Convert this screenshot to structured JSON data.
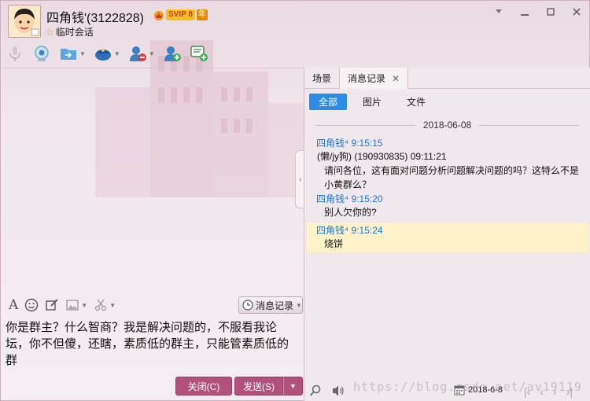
{
  "header": {
    "contact_name": "四角钱'(3122828)",
    "vip_label": "SVIP 8",
    "year_label": "年",
    "session_type": "临时会话"
  },
  "toolbar": {
    "icons": [
      "microphone-icon",
      "video-call-icon",
      "file-transfer-icon",
      "remote-assist-icon",
      "remove-user-icon",
      "add-user-icon",
      "message-icon"
    ]
  },
  "input_toolbar": {
    "history_label": "消息记录"
  },
  "input": {
    "text": "你是群主？什么智商？我是解决问题的，不服看我论坛，你不但傻，还瞎，素质低的群主，只能管素质低的群"
  },
  "actions": {
    "close_label": "关闭(C)",
    "send_label": "发送(S)"
  },
  "right_tabs": [
    {
      "label": "场景"
    },
    {
      "label": "消息记录"
    }
  ],
  "filters": [
    {
      "label": "全部"
    },
    {
      "label": "图片"
    },
    {
      "label": "文件"
    }
  ],
  "history": {
    "date": "2018-06-08",
    "messages": [
      {
        "sender": "四角钱⁴",
        "time": "9:15:15",
        "quote": "(懒/jy狗) (190930835)  09:11:21",
        "body": "请问各位，这有面对问题分析问题解决问题的吗？这特么不是小黄群么？"
      },
      {
        "sender": "四角钱⁴",
        "time": "9:15:20",
        "body": "别人欠你的?"
      },
      {
        "sender": "四角钱⁴",
        "time": "9:15:24",
        "body": "烧饼"
      }
    ]
  },
  "bottom": {
    "calendar_date": "2018-6-8",
    "watermark": "https://blog.csdn.net/av19119"
  },
  "colors": {
    "accent": "#b2517c",
    "link": "#1d78d8",
    "filter_active": "#2d8ce6",
    "highlight": "#fdf2c8"
  }
}
